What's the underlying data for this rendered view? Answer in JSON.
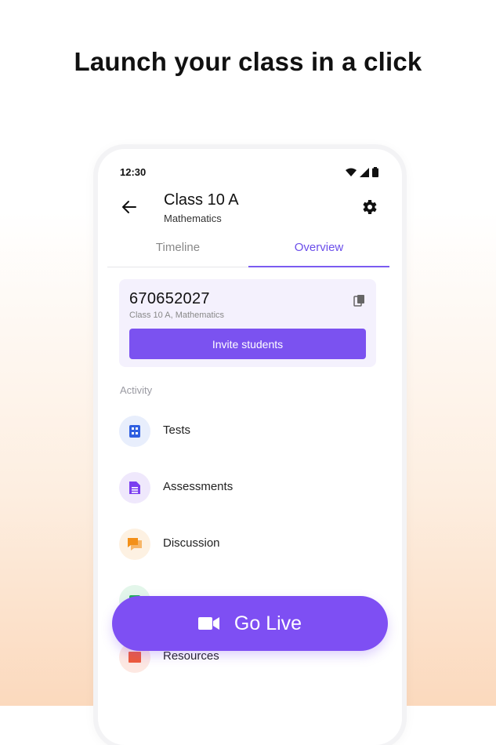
{
  "headline": "Launch your class in a click",
  "status": {
    "time": "12:30"
  },
  "appbar": {
    "title": "Class 10 A",
    "subtitle": "Mathematics"
  },
  "tabs": [
    {
      "label": "Timeline"
    },
    {
      "label": "Overview"
    }
  ],
  "class_card": {
    "code": "670652027",
    "subtitle": "Class 10 A, Mathematics",
    "invite_label": "Invite students"
  },
  "activity": {
    "heading": "Activity",
    "items": [
      {
        "label": "Tests",
        "icon": "tests-icon",
        "color": "#2f5fe0",
        "bg": "#e8eefc"
      },
      {
        "label": "Assessments",
        "icon": "assessments-icon",
        "color": "#7b3ff0",
        "bg": "#efe8fc"
      },
      {
        "label": "Discussion",
        "icon": "discussion-icon",
        "color": "#f39019",
        "bg": "#fdf1e2"
      },
      {
        "label": "",
        "icon": "green-icon",
        "color": "#1fae57",
        "bg": "#e3f6ea"
      },
      {
        "label": "Resources",
        "icon": "resources-icon",
        "color": "#ee5a3a",
        "bg": "#fde8e2"
      }
    ]
  },
  "go_live": {
    "label": "Go Live"
  },
  "colors": {
    "accent": "#7b52f0",
    "tab_active": "#6b4eea"
  }
}
